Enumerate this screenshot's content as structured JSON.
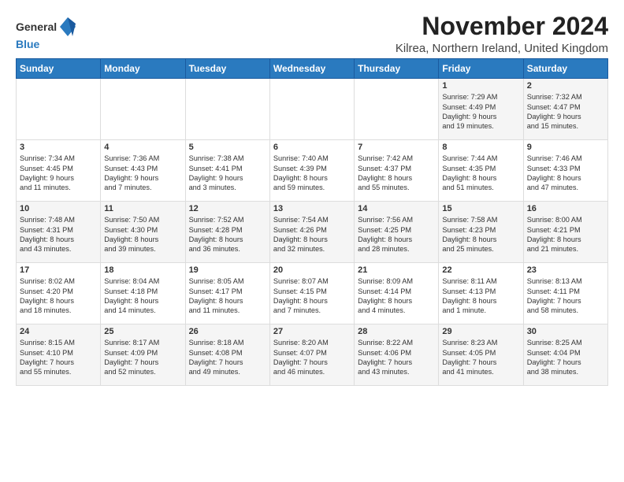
{
  "logo": {
    "general": "General",
    "blue": "Blue"
  },
  "title": "November 2024",
  "subtitle": "Kilrea, Northern Ireland, United Kingdom",
  "headers": [
    "Sunday",
    "Monday",
    "Tuesday",
    "Wednesday",
    "Thursday",
    "Friday",
    "Saturday"
  ],
  "weeks": [
    [
      {
        "day": "",
        "text": ""
      },
      {
        "day": "",
        "text": ""
      },
      {
        "day": "",
        "text": ""
      },
      {
        "day": "",
        "text": ""
      },
      {
        "day": "",
        "text": ""
      },
      {
        "day": "1",
        "text": "Sunrise: 7:29 AM\nSunset: 4:49 PM\nDaylight: 9 hours\nand 19 minutes."
      },
      {
        "day": "2",
        "text": "Sunrise: 7:32 AM\nSunset: 4:47 PM\nDaylight: 9 hours\nand 15 minutes."
      }
    ],
    [
      {
        "day": "3",
        "text": "Sunrise: 7:34 AM\nSunset: 4:45 PM\nDaylight: 9 hours\nand 11 minutes."
      },
      {
        "day": "4",
        "text": "Sunrise: 7:36 AM\nSunset: 4:43 PM\nDaylight: 9 hours\nand 7 minutes."
      },
      {
        "day": "5",
        "text": "Sunrise: 7:38 AM\nSunset: 4:41 PM\nDaylight: 9 hours\nand 3 minutes."
      },
      {
        "day": "6",
        "text": "Sunrise: 7:40 AM\nSunset: 4:39 PM\nDaylight: 8 hours\nand 59 minutes."
      },
      {
        "day": "7",
        "text": "Sunrise: 7:42 AM\nSunset: 4:37 PM\nDaylight: 8 hours\nand 55 minutes."
      },
      {
        "day": "8",
        "text": "Sunrise: 7:44 AM\nSunset: 4:35 PM\nDaylight: 8 hours\nand 51 minutes."
      },
      {
        "day": "9",
        "text": "Sunrise: 7:46 AM\nSunset: 4:33 PM\nDaylight: 8 hours\nand 47 minutes."
      }
    ],
    [
      {
        "day": "10",
        "text": "Sunrise: 7:48 AM\nSunset: 4:31 PM\nDaylight: 8 hours\nand 43 minutes."
      },
      {
        "day": "11",
        "text": "Sunrise: 7:50 AM\nSunset: 4:30 PM\nDaylight: 8 hours\nand 39 minutes."
      },
      {
        "day": "12",
        "text": "Sunrise: 7:52 AM\nSunset: 4:28 PM\nDaylight: 8 hours\nand 36 minutes."
      },
      {
        "day": "13",
        "text": "Sunrise: 7:54 AM\nSunset: 4:26 PM\nDaylight: 8 hours\nand 32 minutes."
      },
      {
        "day": "14",
        "text": "Sunrise: 7:56 AM\nSunset: 4:25 PM\nDaylight: 8 hours\nand 28 minutes."
      },
      {
        "day": "15",
        "text": "Sunrise: 7:58 AM\nSunset: 4:23 PM\nDaylight: 8 hours\nand 25 minutes."
      },
      {
        "day": "16",
        "text": "Sunrise: 8:00 AM\nSunset: 4:21 PM\nDaylight: 8 hours\nand 21 minutes."
      }
    ],
    [
      {
        "day": "17",
        "text": "Sunrise: 8:02 AM\nSunset: 4:20 PM\nDaylight: 8 hours\nand 18 minutes."
      },
      {
        "day": "18",
        "text": "Sunrise: 8:04 AM\nSunset: 4:18 PM\nDaylight: 8 hours\nand 14 minutes."
      },
      {
        "day": "19",
        "text": "Sunrise: 8:05 AM\nSunset: 4:17 PM\nDaylight: 8 hours\nand 11 minutes."
      },
      {
        "day": "20",
        "text": "Sunrise: 8:07 AM\nSunset: 4:15 PM\nDaylight: 8 hours\nand 7 minutes."
      },
      {
        "day": "21",
        "text": "Sunrise: 8:09 AM\nSunset: 4:14 PM\nDaylight: 8 hours\nand 4 minutes."
      },
      {
        "day": "22",
        "text": "Sunrise: 8:11 AM\nSunset: 4:13 PM\nDaylight: 8 hours\nand 1 minute."
      },
      {
        "day": "23",
        "text": "Sunrise: 8:13 AM\nSunset: 4:11 PM\nDaylight: 7 hours\nand 58 minutes."
      }
    ],
    [
      {
        "day": "24",
        "text": "Sunrise: 8:15 AM\nSunset: 4:10 PM\nDaylight: 7 hours\nand 55 minutes."
      },
      {
        "day": "25",
        "text": "Sunrise: 8:17 AM\nSunset: 4:09 PM\nDaylight: 7 hours\nand 52 minutes."
      },
      {
        "day": "26",
        "text": "Sunrise: 8:18 AM\nSunset: 4:08 PM\nDaylight: 7 hours\nand 49 minutes."
      },
      {
        "day": "27",
        "text": "Sunrise: 8:20 AM\nSunset: 4:07 PM\nDaylight: 7 hours\nand 46 minutes."
      },
      {
        "day": "28",
        "text": "Sunrise: 8:22 AM\nSunset: 4:06 PM\nDaylight: 7 hours\nand 43 minutes."
      },
      {
        "day": "29",
        "text": "Sunrise: 8:23 AM\nSunset: 4:05 PM\nDaylight: 7 hours\nand 41 minutes."
      },
      {
        "day": "30",
        "text": "Sunrise: 8:25 AM\nSunset: 4:04 PM\nDaylight: 7 hours\nand 38 minutes."
      }
    ]
  ]
}
